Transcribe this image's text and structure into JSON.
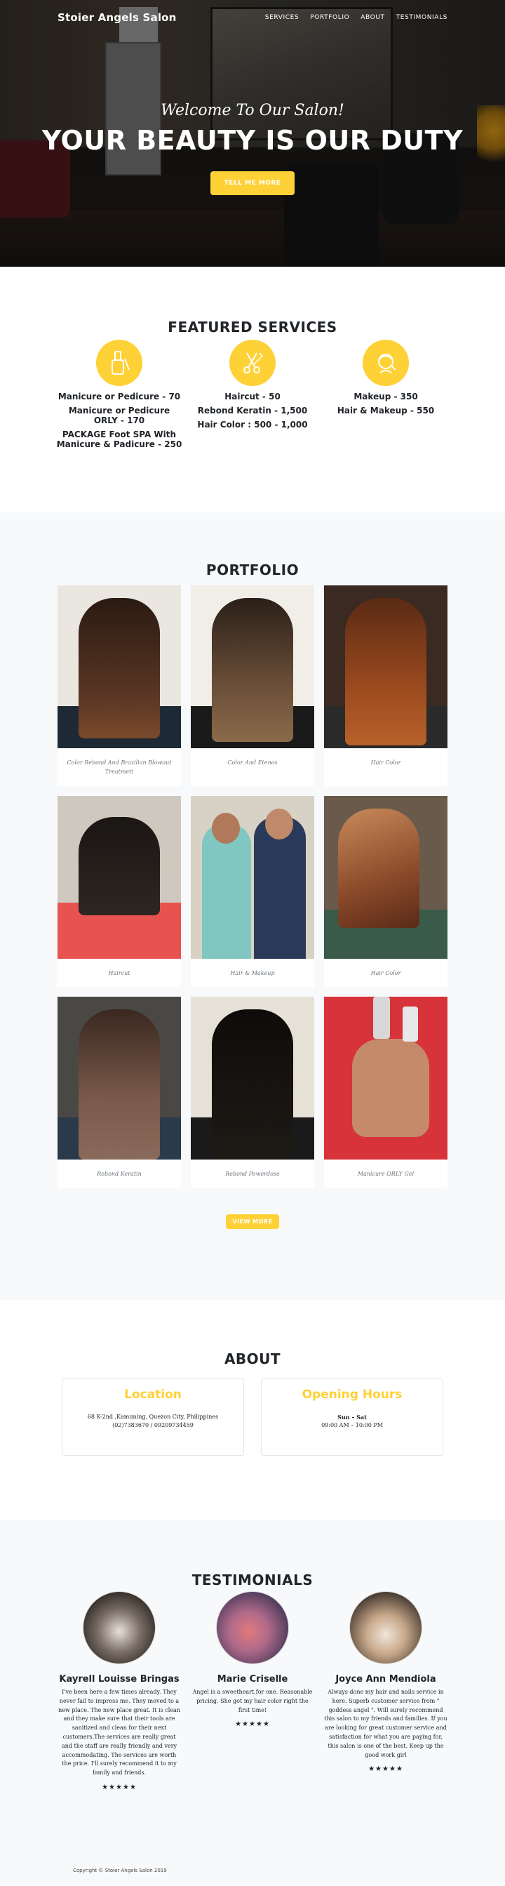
{
  "navbar": {
    "brand": "Stoier Angels Salon",
    "links": [
      "SERVICES",
      "PORTFOLIO",
      "ABOUT",
      "TESTIMONIALS"
    ]
  },
  "hero": {
    "subtitle": "Welcome To Our Salon!",
    "title": "YOUR BEAUTY IS OUR DUTY",
    "button": "TELL ME MORE"
  },
  "services": {
    "title": "FEATURED SERVICES",
    "columns": [
      {
        "icon": "nail-polish-icon",
        "items": [
          "Manicure or Pedicure - 70",
          "Manicure or Pedicure ORLY - 170",
          "PACKAGE Foot SPA With Manicure & Padicure - 250"
        ]
      },
      {
        "icon": "scissors-comb-icon",
        "items": [
          "Haircut - 50",
          "Rebond Keratin - 1,500",
          "Hair Color : 500 - 1,000"
        ]
      },
      {
        "icon": "makeup-face-icon",
        "items": [
          "Makeup - 350",
          "Hair & Makeup - 550"
        ]
      }
    ]
  },
  "portfolio": {
    "title": "PORTFOLIO",
    "items": [
      "Color Rebond And Brazilian Blowout Treatmeti",
      "Color And Etenos",
      "Hair Color",
      "Haircut",
      "Hair & Makeup",
      "Hair Color",
      "Rebond Keratin",
      "Rebond Powerdose",
      "Manicure ORLY Gel"
    ],
    "button": "VIEW MORE"
  },
  "about": {
    "title": "ABOUT",
    "location": {
      "heading": "Location",
      "lines": [
        "68 K-2nd ,Kamuning, Quezon City, Philippines",
        "(02)7383670 / 09209734459"
      ]
    },
    "hours": {
      "heading": "Opening Hours",
      "lines": [
        "Sun – Sat",
        "09:00 AM – 10:00 PM"
      ]
    }
  },
  "testimonials": {
    "title": "TESTIMONIALS",
    "items": [
      {
        "name": "Kayrell Louisse Bringas",
        "text": "I've been here a few times already. They never fail to impress me. They moved to a new place. The new place great. It is clean and they make sure that their tools are sanitized and clean for their next customers.The services are really great and the staff are really friendly and very accommodating. The services are worth the price. I'll surely recommend it to my family and friends.",
        "stars": "★★★★★"
      },
      {
        "name": "Marie Criselle",
        "text": "Angel is a sweetheart,for one. Reasonable pricing. She got my hair color right the first time!",
        "stars": "★★★★★"
      },
      {
        "name": "Joyce Ann Mendiola",
        "text": "Always done my hair and nails service in here. Superb customer service from \" goddess angel \". Will surely recommend this salon to my friends and families. If you are looking for great customer service and satisfaction for what you are paying for, this salon is one of the best. Keep up the good work girl",
        "stars": "★★★★★"
      }
    ]
  },
  "footer": {
    "copyright": "Copyright © Stoier Angels Salon 2019"
  },
  "colors": {
    "accent": "#fed136",
    "dark": "#212529",
    "light_bg": "#f8f9fa"
  }
}
